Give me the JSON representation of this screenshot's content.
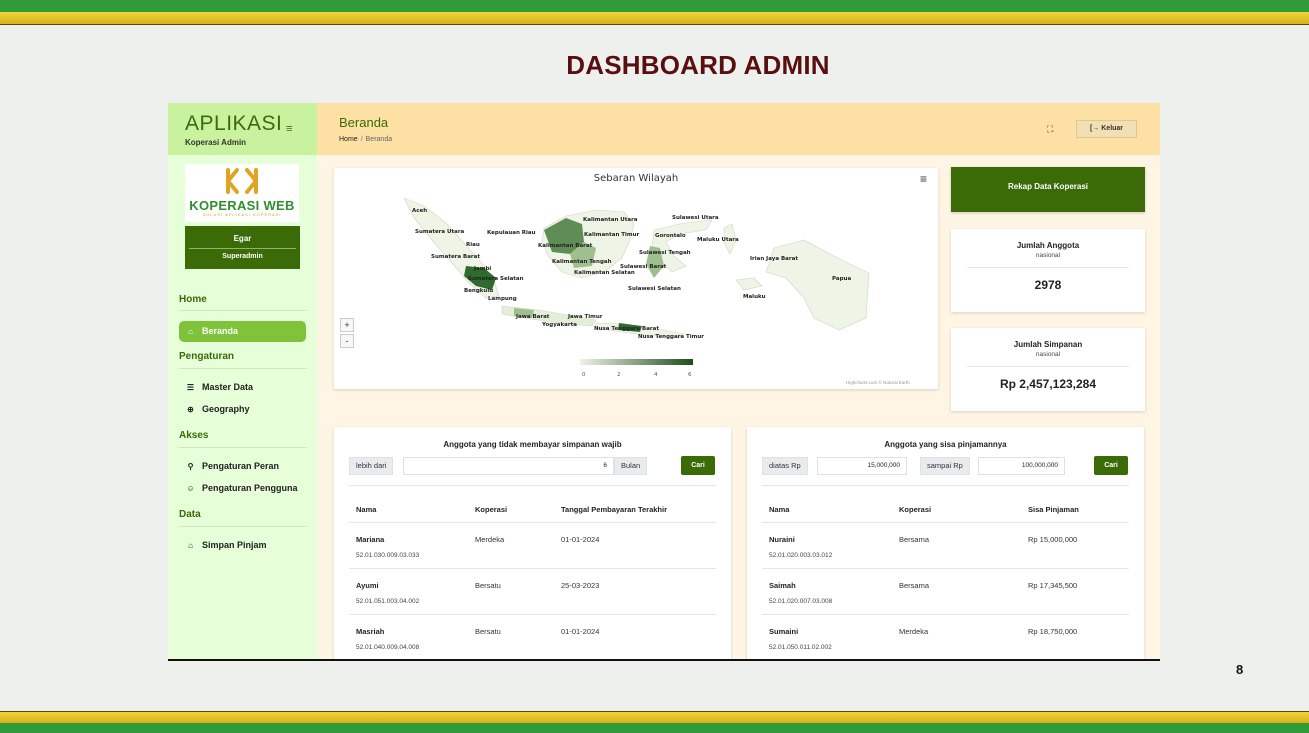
{
  "slide": {
    "title": "DASHBOARD ADMIN",
    "page_number": "8"
  },
  "brand": {
    "title": "APLIKASI",
    "subtitle": "Koperasi Admin",
    "logo_text": "KOPERASI WEB",
    "logo_tagline": "SOLUSI APLIKASI KOPERASI"
  },
  "user": {
    "name": "Egar",
    "role": "Superadmin"
  },
  "sidebar": {
    "sections": {
      "home": "Home",
      "pengaturan": "Pengaturan",
      "akses": "Akses",
      "data": "Data"
    },
    "items": {
      "beranda": "Beranda",
      "master_data": "Master Data",
      "geography": "Geography",
      "pengaturan_peran": "Pengaturan Peran",
      "pengaturan_pengguna": "Pengaturan Pengguna",
      "simpan_pinjam": "Simpan Pinjam"
    }
  },
  "header": {
    "title": "Beranda",
    "breadcrumb_home": "Home",
    "breadcrumb_sep": "/",
    "breadcrumb_current": "Beranda",
    "logout_label": "Keluar"
  },
  "map": {
    "title": "Sebaran Wilayah",
    "credits": "Highcharts.com © Natural Earth",
    "legend_ticks": [
      "0",
      "2",
      "4",
      "6"
    ],
    "labels": {
      "aceh": "Aceh",
      "sumut": "Sumatera Utara",
      "riau": "Riau",
      "kepri": "Kepulauan Riau",
      "sumbar": "Sumatera Barat",
      "jambi": "Jambi",
      "sumsel": "Sumatera Selatan",
      "bengkulu": "Bengkulu",
      "lampung": "Lampung",
      "jabar": "Jawa Barat",
      "yogya": "Yogyakarta",
      "jatim": "Jawa Timur",
      "kaltara": "Kalimantan Utara",
      "kaltim": "Kalimantan Timur",
      "kalbar": "Kalimantan Barat",
      "kalteng": "Kalimantan Tengah",
      "kalsel": "Kalimantan Selatan",
      "sulut": "Sulawesi Utara",
      "gorontalo": "Gorontalo",
      "sulteng": "Sulawesi Tengah",
      "sulbar": "Sulawesi Barat",
      "sulsel": "Sulawesi Selatan",
      "malut": "Maluku Utara",
      "maluku": "Maluku",
      "ijb": "Irian Jaya Barat",
      "papua": "Papua",
      "ntb": "Nusa Tenggara Barat",
      "ntt": "Nusa Tenggara Timur"
    }
  },
  "stats": {
    "rekap_button": "Rekap Data Koperasi",
    "anggota": {
      "label": "Jumlah Anggota",
      "sub": "nasional",
      "value": "2978"
    },
    "simpanan": {
      "label": "Jumlah Simpanan",
      "sub": "nasional",
      "value": "Rp 2,457,123,284"
    }
  },
  "table_simpanan": {
    "title": "Anggota yang tidak membayar simpanan wajib",
    "prefix": "lebih dari",
    "value": "6",
    "suffix": "Bulan",
    "button": "Cari",
    "headers": [
      "Nama",
      "Koperasi",
      "Tanggal Pembayaran Terakhir"
    ],
    "rows": [
      {
        "name": "Mariana",
        "id": "52.01.030.009.03.033",
        "koperasi": "Merdeka",
        "tanggal": "01-01-2024"
      },
      {
        "name": "Ayumi",
        "id": "52.01.051.003.04.002",
        "koperasi": "Bersatu",
        "tanggal": "25-03-2023"
      },
      {
        "name": "Masriah",
        "id": "52.01.040.009.04.008",
        "koperasi": "Bersatu",
        "tanggal": "01-01-2024"
      }
    ]
  },
  "table_pinjaman": {
    "title": "Anggota yang sisa pinjamannya",
    "prefix_min": "diatas Rp",
    "value_min": "15,000,000",
    "prefix_max": "sampai Rp",
    "value_max": "100,000,000",
    "button": "Cari",
    "headers": [
      "Nama",
      "Koperasi",
      "Sisa Pinjaman"
    ],
    "rows": [
      {
        "name": "Nuraini",
        "id": "52.01.020.003.03.012",
        "koperasi": "Bersama",
        "sisa": "Rp 15,000,000"
      },
      {
        "name": "Saimah",
        "id": "52.01.020.007.03.008",
        "koperasi": "Bersama",
        "sisa": "Rp 17,345,500"
      },
      {
        "name": "Sumaini",
        "id": "52.01.050.011.02.002",
        "koperasi": "Merdeka",
        "sisa": "Rp 18,750,000"
      }
    ]
  },
  "colors": {
    "primary_green": "#3a6b06",
    "accent_green": "#7ec33a",
    "header_bg": "#fde0a4",
    "sidebar_bg": "#e6ffd8",
    "title_red": "#5a0f0f"
  }
}
